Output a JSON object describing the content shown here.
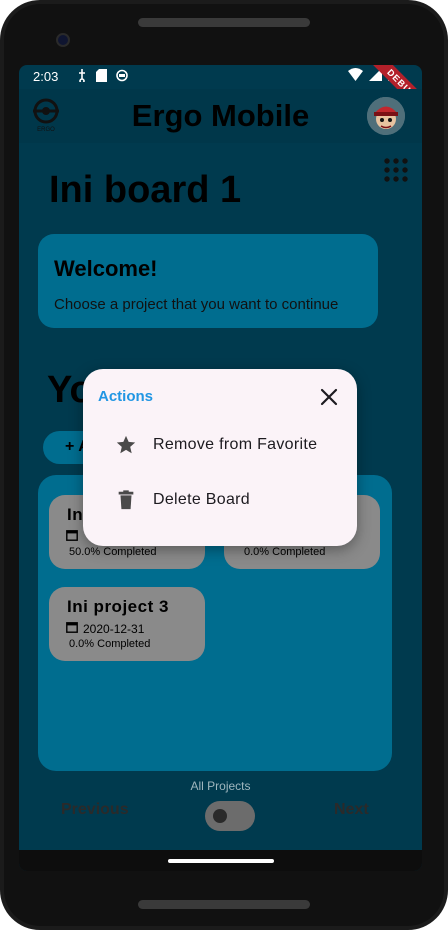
{
  "status_bar": {
    "time": "2:03",
    "debug_label": "DEBUG"
  },
  "app_bar": {
    "title": "Ergo Mobile",
    "logo_text": "ERGO"
  },
  "board": {
    "title": "Ini board 1"
  },
  "welcome": {
    "title": "Welcome!",
    "subtitle": "Choose a project that you want to continue"
  },
  "section": {
    "heading": "Yo",
    "add_label": "+ A"
  },
  "projects": [
    {
      "name": "In",
      "date": "",
      "completed": "50.0% Completed"
    },
    {
      "name": "",
      "date": "",
      "completed": "0.0% Completed"
    },
    {
      "name": "Ini project 3",
      "date": "2020-12-31",
      "completed": "0.0% Completed"
    }
  ],
  "footer": {
    "all_projects": "All Projects",
    "previous": "Previous",
    "next": "Next"
  },
  "dialog": {
    "title": "Actions",
    "actions": [
      {
        "label": "Remove from Favorite",
        "icon": "star-icon"
      },
      {
        "label": "Delete Board",
        "icon": "trash-icon"
      }
    ]
  },
  "colors": {
    "accent": "#2196e3",
    "card": "#006d8f",
    "dialog_bg": "#fbf3f8"
  }
}
